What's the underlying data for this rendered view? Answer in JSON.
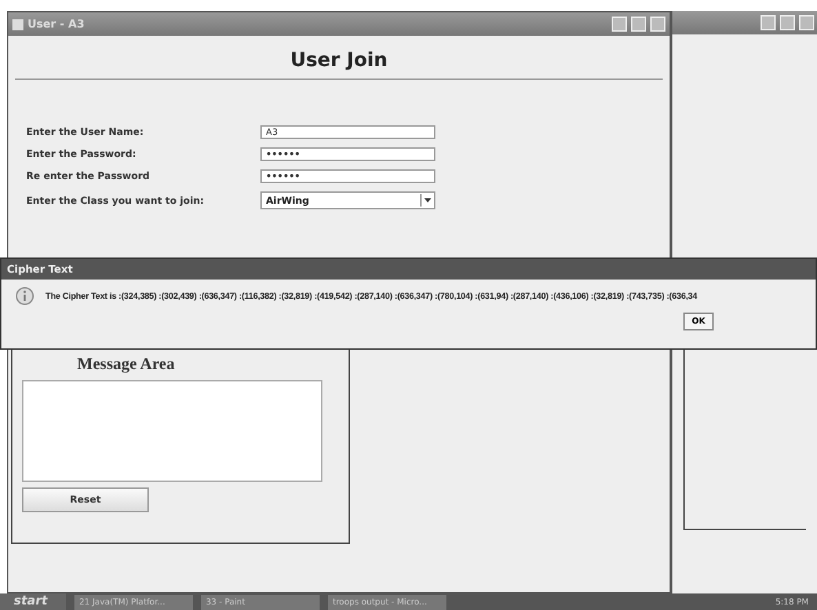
{
  "window": {
    "title": "User - A3",
    "heading": "User Join"
  },
  "form": [
    {
      "kind": "text",
      "label": "Enter the User Name:",
      "value": "A3"
    },
    {
      "kind": "password",
      "label": "Enter the Password:",
      "value": "••••••"
    },
    {
      "kind": "password",
      "label": "Re enter the Password",
      "value": "••••••"
    },
    {
      "kind": "select",
      "label": "Enter the Class you want to join:",
      "value": "AirWing"
    }
  ],
  "message_panel": {
    "title": "Message Area",
    "button": "Reset"
  },
  "dialog": {
    "title": "Cipher Text",
    "message": "The Cipher Text is :(324,385) :(302,439) :(636,347) :(116,382) :(32,819) :(419,542) :(287,140) :(636,347) :(780,104) :(631,94) :(287,140) :(436,106) :(32,819) :(743,735) :(636,34",
    "button": "OK"
  },
  "taskbar": {
    "start": "start",
    "tasks": [
      {
        "label": "21 Java(TM) Platfor...",
        "selected": false
      },
      {
        "label": "33 - Paint",
        "selected": false
      },
      {
        "label": "troops output - Micro...",
        "selected": false
      }
    ],
    "clock": "5:18 PM"
  }
}
